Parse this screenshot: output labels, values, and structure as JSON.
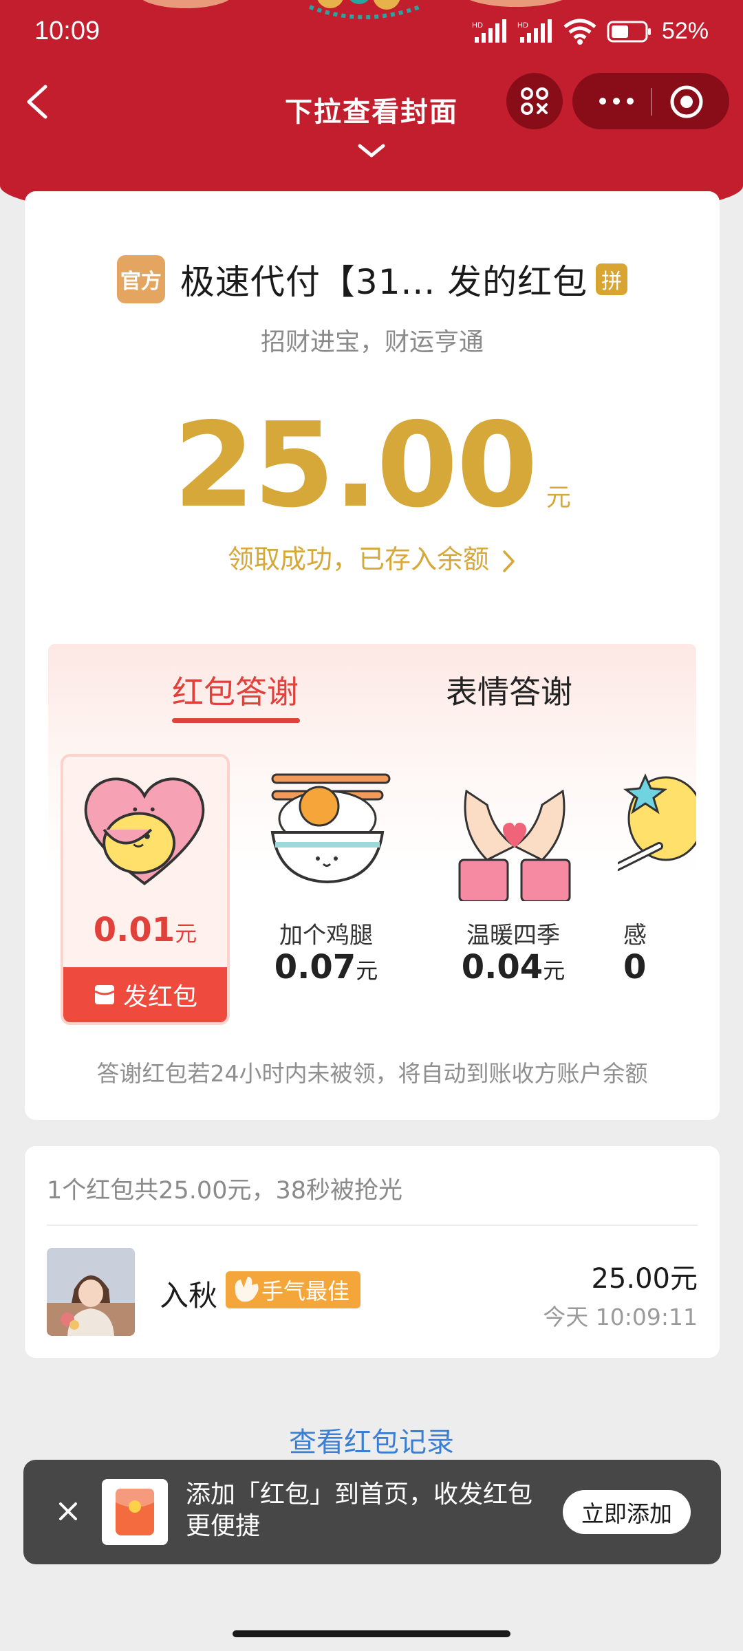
{
  "status_bar": {
    "time": "10:09",
    "battery_text": "52%",
    "icons": [
      "hd-signal-icon",
      "hd-signal-icon",
      "wifi-icon",
      "battery-icon"
    ]
  },
  "nav": {
    "title": "下拉查看封面",
    "icons": [
      "back-icon",
      "chevron-down-icon",
      "scan-icon",
      "more-icon",
      "target-icon"
    ]
  },
  "packet": {
    "official_badge": "官方",
    "sender": "极速代付【31... 发的红包",
    "pin_badge": "拼",
    "blessing": "招财进宝，财运亨通",
    "amount": "25.00",
    "amount_unit": "元",
    "status_link": "领取成功，已存入余额"
  },
  "thanks": {
    "tabs": [
      {
        "label": "红包答谢",
        "active": true
      },
      {
        "label": "表情答谢",
        "active": false
      }
    ],
    "gifts": [
      {
        "name": "",
        "price": "0.01",
        "unit": "元",
        "icon": "heart-hug-icon",
        "selected": true
      },
      {
        "name": "加个鸡腿",
        "price": "0.07",
        "unit": "元",
        "icon": "rice-bowl-icon"
      },
      {
        "name": "温暖四季",
        "price": "0.04",
        "unit": "元",
        "icon": "heart-hands-icon"
      },
      {
        "name": "感",
        "price": "0",
        "unit": "",
        "icon": "star-wand-icon"
      }
    ],
    "send_button": "发红包",
    "note": "答谢红包若24小时内未被领，将自动到账收方账户余额"
  },
  "records": {
    "summary": "1个红包共25.00元，38秒被抢光",
    "items": [
      {
        "name": "入秋",
        "badge": "手气最佳",
        "amount": "25.00元",
        "time": "今天 10:09:11"
      }
    ],
    "view_all": "查看红包记录"
  },
  "toast": {
    "text": "添加「红包」到首页，收发红包更便捷",
    "button": "立即添加"
  },
  "colors": {
    "header_red": "#c31e2e",
    "gold": "#d6a83a",
    "accent_red": "#e0413a",
    "link_blue": "#3b7fd3"
  }
}
